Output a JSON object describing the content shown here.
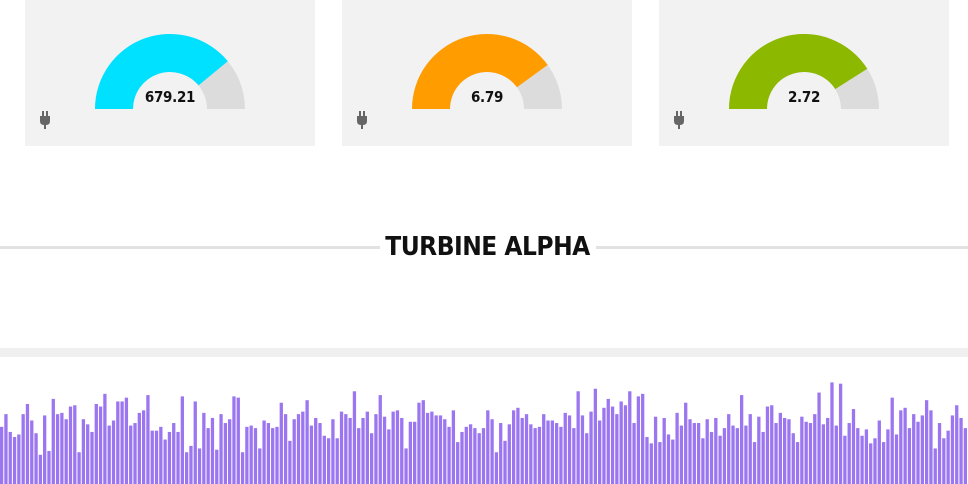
{
  "gauges": [
    {
      "value_label": "679.21",
      "fill": 0.78,
      "color": "#00e0ff",
      "icon": "plug-icon"
    },
    {
      "value_label": "6.79",
      "fill": 0.8,
      "color": "#ff9c00",
      "icon": "plug-icon"
    },
    {
      "value_label": "2.72",
      "fill": 0.82,
      "color": "#8db800",
      "icon": "plug-icon"
    }
  ],
  "section": {
    "title": "TURBINE ALPHA"
  },
  "colors": {
    "track": "#dcdcdc",
    "bars": "#9b76f0",
    "card": "#f2f2f2"
  },
  "chart_data": {
    "type": "bar",
    "ylim": [
      0,
      100
    ],
    "values": [
      45,
      55,
      41,
      37,
      39,
      55,
      63,
      50,
      40,
      23,
      54,
      26,
      67,
      55,
      56,
      51,
      61,
      62,
      25,
      51,
      47,
      41,
      63,
      61,
      71,
      46,
      50,
      65,
      65,
      68,
      46,
      48,
      56,
      58,
      70,
      42,
      42,
      45,
      35,
      41,
      48,
      41,
      69,
      25,
      30,
      65,
      28,
      56,
      44,
      52,
      27,
      55,
      48,
      51,
      69,
      68,
      25,
      45,
      46,
      44,
      28,
      50,
      48,
      44,
      45,
      64,
      55,
      34,
      51,
      55,
      57,
      66,
      46,
      52,
      48,
      38,
      36,
      51,
      36,
      57,
      55,
      52,
      73,
      44,
      52,
      57,
      40,
      55,
      70,
      53,
      43,
      57,
      58,
      52,
      28,
      49,
      49,
      64,
      66,
      56,
      57,
      54,
      54,
      51,
      45,
      58,
      33,
      41,
      45,
      47,
      44,
      40,
      44,
      58,
      51,
      25,
      48,
      34,
      47,
      58,
      60,
      52,
      55,
      47,
      44,
      45,
      55,
      50,
      50,
      48,
      45,
      56,
      54,
      44,
      73,
      54,
      40,
      57,
      75,
      50,
      60,
      67,
      61,
      55,
      65,
      62,
      73,
      48,
      69,
      71,
      37,
      32,
      53,
      33,
      52,
      39,
      35,
      56,
      46,
      64,
      51,
      48,
      48,
      36,
      51,
      41,
      52,
      38,
      44,
      55,
      46,
      44,
      70,
      46,
      55,
      33,
      53,
      41,
      61,
      62,
      48,
      56,
      52,
      51,
      40,
      33,
      53,
      49,
      48,
      55,
      72,
      47,
      52,
      80,
      46,
      79,
      38,
      48,
      59,
      44,
      38,
      43,
      32,
      36,
      50,
      33,
      43,
      68,
      39,
      58,
      60,
      44,
      55,
      49,
      54,
      66,
      58,
      28,
      48,
      36,
      42,
      54,
      62,
      52,
      44
    ]
  }
}
